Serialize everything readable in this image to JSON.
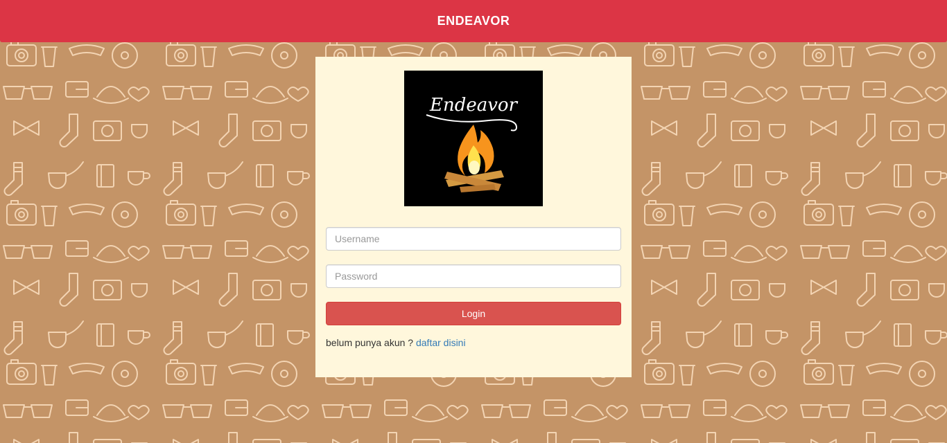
{
  "navbar": {
    "brand": "ENDEAVOR"
  },
  "logo": {
    "text": "Endeavor",
    "icon": "campfire-icon"
  },
  "form": {
    "username_placeholder": "Username",
    "username_value": "",
    "password_placeholder": "Password",
    "password_value": "",
    "login_label": "Login",
    "register_prompt": "belum punya akun ?",
    "register_link": "daftar disini"
  },
  "colors": {
    "navbar": "#dc3545",
    "background": "#c49467",
    "pattern_stroke": "#f3d4b3",
    "panel": "#fff7dc",
    "login_button": "#d9534f",
    "link": "#337ab7"
  }
}
